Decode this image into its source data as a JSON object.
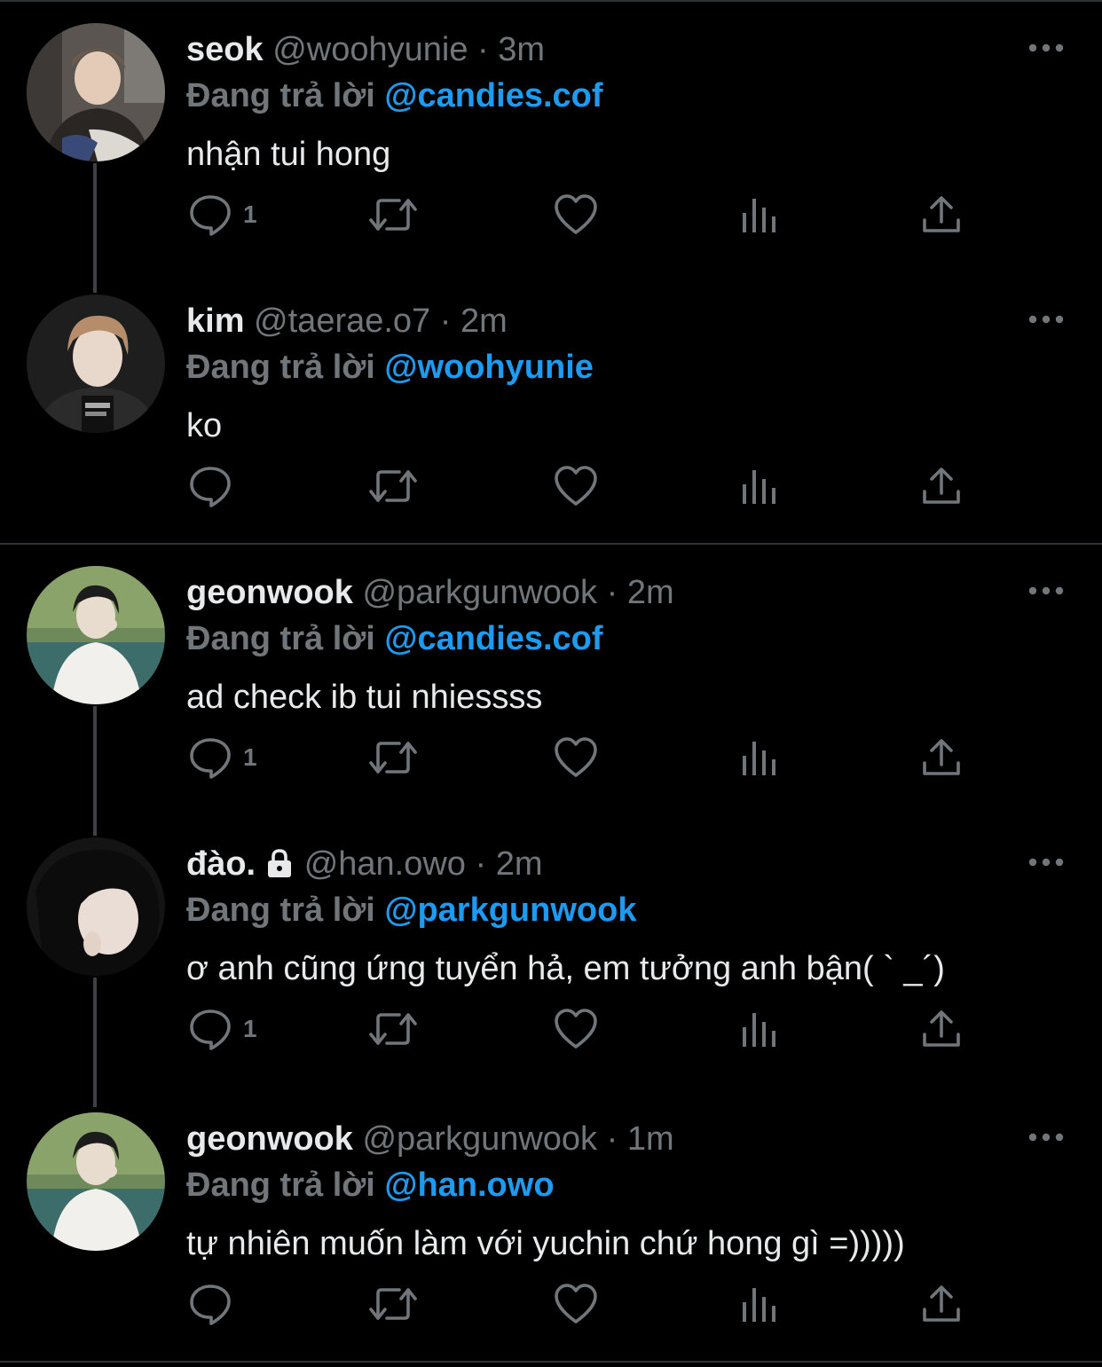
{
  "reply_prefix": "Đang trả lời",
  "colors": {
    "background": "#000000",
    "text": "#e7e9ea",
    "muted": "#71767b",
    "mention": "#1d9bf0",
    "divider": "#2f3336"
  },
  "tweets": [
    {
      "name": "seok",
      "handle": "@woohyunie",
      "dot": "·",
      "time": "3m",
      "reply_to": "@candies.cof",
      "text": "nhận tui hong",
      "reply_count": "1",
      "locked": false
    },
    {
      "name": "kim",
      "handle": "@taerae.o7",
      "dot": "·",
      "time": "2m",
      "reply_to": "@woohyunie",
      "text": "ko",
      "reply_count": "",
      "locked": false
    },
    {
      "name": "geonwook",
      "handle": "@parkgunwook",
      "dot": "·",
      "time": "2m",
      "reply_to": "@candies.cof",
      "text": "ad check ib tui nhiessss",
      "reply_count": "1",
      "locked": false
    },
    {
      "name": "đào.",
      "handle": "@han.owo",
      "dot": "·",
      "time": "2m",
      "reply_to": "@parkgunwook",
      "text": "ơ anh cũng ứng tuyển hả, em tưởng anh bận( ` _´)",
      "reply_count": "1",
      "locked": true
    },
    {
      "name": "geonwook",
      "handle": "@parkgunwook",
      "dot": "·",
      "time": "1m",
      "reply_to": "@han.owo",
      "text": "tự nhiên muốn làm với yuchin chứ hong gì =)))))",
      "reply_count": "",
      "locked": false
    }
  ],
  "icons": {
    "reply": "reply-icon",
    "retweet": "retweet-icon",
    "like": "heart-icon",
    "analytics": "analytics-icon",
    "share": "share-icon",
    "more": "more-dots-icon",
    "lock": "lock-icon"
  }
}
